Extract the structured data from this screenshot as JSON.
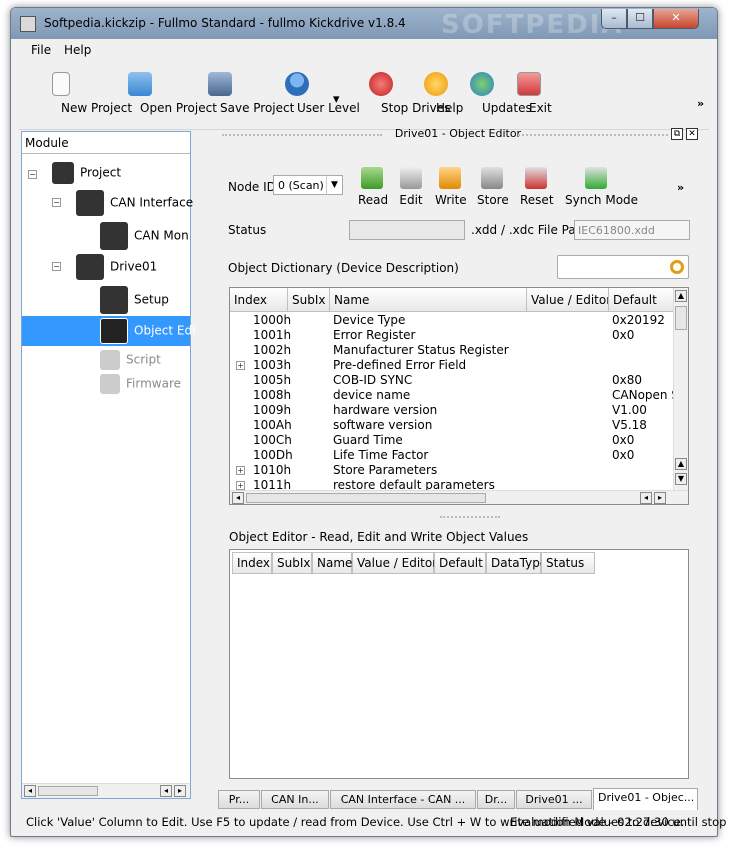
{
  "window": {
    "title": "Softpedia.kickzip - Fullmo Standard - fullmo Kickdrive v1.8.4",
    "watermark": "SOFTPEDIA",
    "min": "–",
    "max": "☐",
    "close": "✕"
  },
  "menu": {
    "file": "File",
    "help": "Help"
  },
  "toolbar": {
    "new_project": "New Project",
    "open_project": "Open Project",
    "save_project": "Save Project",
    "user_level": "User Level",
    "stop_drives": "Stop Drives",
    "help": "Help",
    "updates": "Updates",
    "exit": "Exit",
    "more": "»",
    "dropdown": "▾"
  },
  "tree": {
    "header": "Module",
    "project": "Project",
    "can_interface": "CAN Interface",
    "can_monitor": "CAN Mon",
    "drive01": "Drive01",
    "setup": "Setup",
    "object_editor": "Object Edi",
    "script": "Script",
    "firmware": "Firmware"
  },
  "editor": {
    "title": "Drive01 - Object Editor",
    "node_id_label": "Node ID",
    "node_id_value": "0 (Scan)",
    "actions": {
      "read": "Read",
      "edit": "Edit",
      "write": "Write",
      "store": "Store",
      "reset": "Reset",
      "synch_mode": "Synch Mode",
      "more": "»"
    },
    "status_label": "Status",
    "path_label": ".xdd / .xdc File Path",
    "path_value": "IEC61800.xdd",
    "dict_label": "Object Dictionary (Device Description)",
    "columns": {
      "index": "Index",
      "subix": "SubIx",
      "name": "Name",
      "value_editor": "Value / Editor",
      "default": "Default"
    },
    "rows": [
      {
        "index": "1000h",
        "name": "Device Type",
        "default": "0x20192"
      },
      {
        "index": "1001h",
        "name": "Error Register",
        "default": "0x0"
      },
      {
        "index": "1002h",
        "name": "Manufacturer Status Register",
        "default": ""
      },
      {
        "index": "1003h",
        "name": "Pre-defined Error Field",
        "default": ""
      },
      {
        "index": "1005h",
        "name": "COB-ID SYNC",
        "default": "0x80"
      },
      {
        "index": "1008h",
        "name": "device name",
        "default": "CANopen S"
      },
      {
        "index": "1009h",
        "name": "hardware version",
        "default": "V1.00"
      },
      {
        "index": "100Ah",
        "name": "software version",
        "default": "V5.18"
      },
      {
        "index": "100Ch",
        "name": "Guard Time",
        "default": "0x0"
      },
      {
        "index": "100Dh",
        "name": "Life Time Factor",
        "default": "0x0"
      },
      {
        "index": "1010h",
        "name": "Store Parameters",
        "default": ""
      },
      {
        "index": "1011h",
        "name": "restore default parameters",
        "default": ""
      }
    ],
    "values_label": "Object Editor - Read, Edit and Write Object Values",
    "values_columns": {
      "index": "Index",
      "subix": "SubIx",
      "name": "Name",
      "value_editor": "Value / Editor",
      "default": "Default",
      "datatype": "DataType",
      "status": "Status"
    }
  },
  "tabs": [
    "Pr...",
    "CAN In...",
    "CAN Interface - CAN ...",
    "Dr...",
    "Drive01 ...",
    "Drive01 - Objec..."
  ],
  "statusbar": {
    "hint": "Click 'Value' Column to Edit. Use F5 to update / read from Device. Use Ctrl + W to write modified values to device.",
    "eval": "Evaluation Mode - 02:27:30 until stop"
  }
}
